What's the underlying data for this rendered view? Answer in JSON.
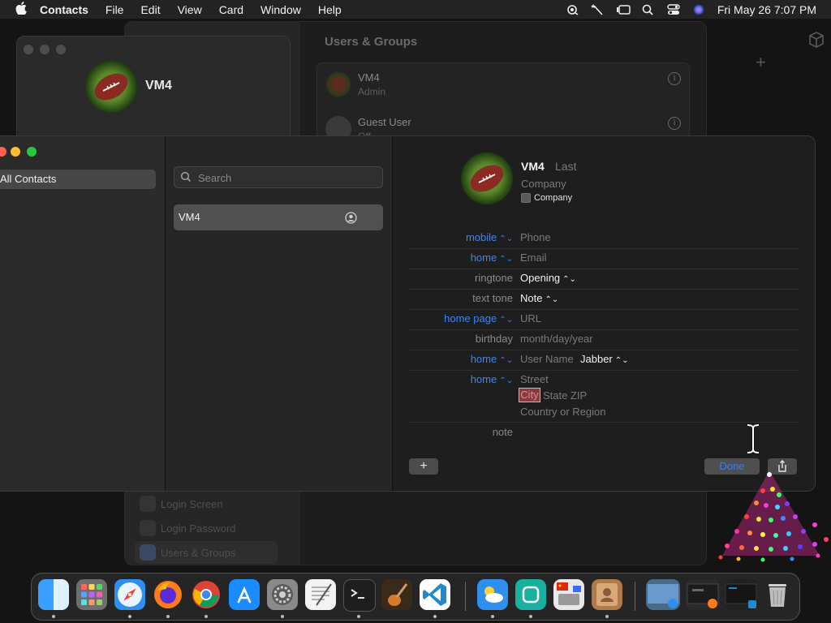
{
  "menubar": {
    "app_name": "Contacts",
    "items": [
      "File",
      "Edit",
      "View",
      "Card",
      "Window",
      "Help"
    ],
    "clock": "Fri May 26  7:07 PM"
  },
  "settings_window": {
    "title": "Users & Groups",
    "users": [
      {
        "name": "VM4",
        "role": "Admin"
      },
      {
        "name": "Guest User",
        "role": "Off"
      }
    ],
    "sidebar_items": [
      "Login Screen",
      "Login Password",
      "Users & Groups"
    ]
  },
  "mini_window": {
    "contact_name": "VM4"
  },
  "contacts": {
    "groups": [
      "All Contacts"
    ],
    "search_placeholder": "Search",
    "list": [
      {
        "name": "VM4"
      }
    ],
    "card": {
      "first_name": "VM4",
      "last_name_placeholder": "Last",
      "company_placeholder": "Company",
      "company_checkbox_label": "Company",
      "fields": [
        {
          "label": "mobile",
          "value": "Phone"
        },
        {
          "label": "home",
          "value": "Email"
        },
        {
          "label": "ringtone",
          "value": "Opening"
        },
        {
          "label": "text tone",
          "value": "Note"
        },
        {
          "label": "home page",
          "value": "URL"
        },
        {
          "label": "birthday",
          "value": "month/day/year"
        },
        {
          "label": "home",
          "value": "User Name",
          "service": "Jabber"
        },
        {
          "label": "home",
          "value": "Street"
        },
        {
          "label": "note",
          "value": ""
        }
      ],
      "address_city": "City",
      "address_state_zip": "State ZIP",
      "address_country": "Country or Region"
    },
    "buttons": {
      "add": "+",
      "done": "Done"
    }
  },
  "dock": {
    "apps": [
      "Finder",
      "Launchpad",
      "Safari",
      "Firefox",
      "Chrome",
      "App Store",
      "System Settings",
      "TextEdit",
      "Terminal",
      "GarageBand",
      "Visual Studio Code",
      "Weather",
      "Screen Time",
      "Input Sources",
      "Contacts",
      "Window Preview 1",
      "Window Preview 2",
      "Window Preview 3",
      "Trash"
    ]
  }
}
